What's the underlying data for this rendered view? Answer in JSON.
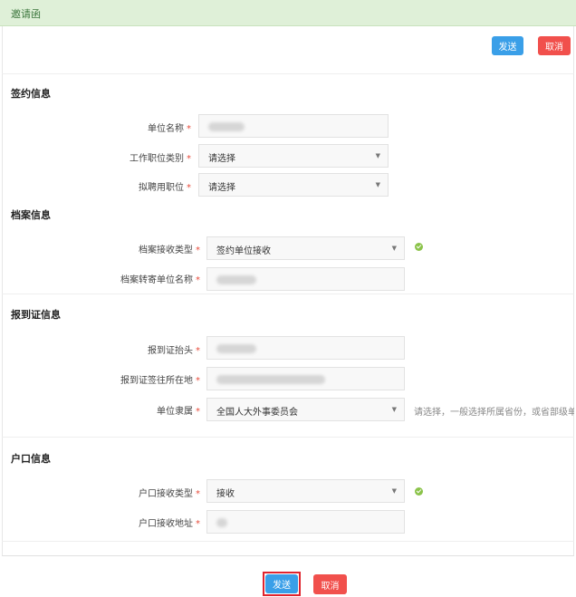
{
  "window": {
    "title": "邀请函"
  },
  "toolbar": {
    "send_label": "发送",
    "cancel_label": "取消"
  },
  "sections": {
    "contract": {
      "title": "签约信息",
      "fields": [
        {
          "label": "单位名称",
          "value": ""
        },
        {
          "label": "工作职位类别",
          "value": "请选择"
        },
        {
          "label": "拟聘用职位",
          "value": "请选择"
        }
      ]
    },
    "archive": {
      "title": "档案信息",
      "fields": [
        {
          "label": "档案接收类型",
          "value": "签约单位接收"
        },
        {
          "label": "档案转寄单位名称",
          "value": ""
        }
      ]
    },
    "report": {
      "title": "报到证信息",
      "fields": [
        {
          "label": "报到证抬头",
          "value": ""
        },
        {
          "label": "报到证签往所在地",
          "value": ""
        },
        {
          "label": "单位隶属",
          "value": "全国人大外事委员会"
        }
      ],
      "hint": "请选择，一般选择所属省份，或省部级单位"
    },
    "hukou": {
      "title": "户口信息",
      "fields": [
        {
          "label": "户口接收类型",
          "value": "接收"
        },
        {
          "label": "户口接收地址",
          "value": ""
        }
      ]
    }
  },
  "footer": {
    "send_label": "发送",
    "cancel_label": "取消"
  }
}
